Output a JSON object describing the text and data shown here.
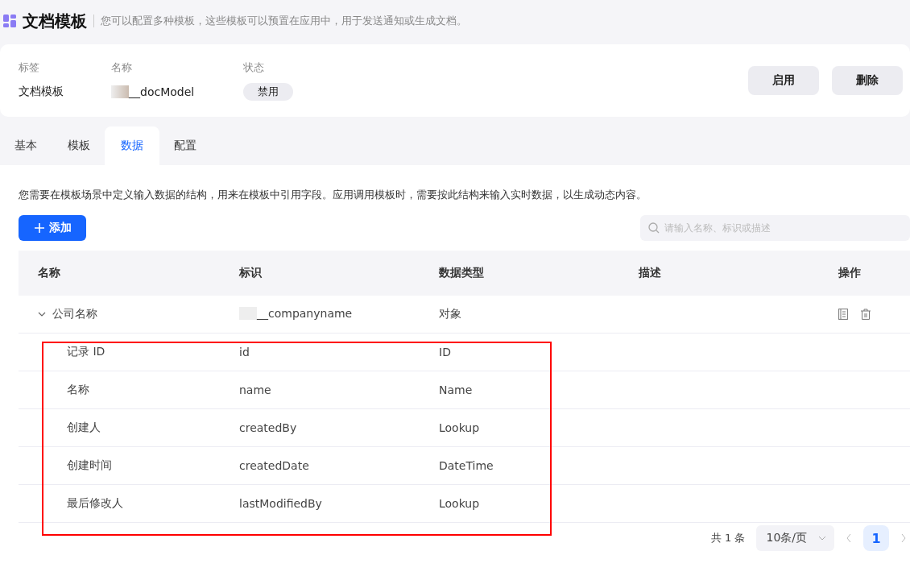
{
  "header": {
    "title": "文档模板",
    "description": "您可以配置多种模板，这些模板可以预置在应用中，用于发送通知或生成文档。"
  },
  "info": {
    "fields": [
      {
        "label": "标签",
        "value": "文档模板",
        "kind": "text"
      },
      {
        "label": "名称",
        "value": "__docModel",
        "kind": "redacted"
      },
      {
        "label": "状态",
        "value": "禁用",
        "kind": "tag"
      }
    ],
    "buttons": [
      "启用",
      "删除"
    ]
  },
  "tabs": [
    {
      "label": "基本",
      "selected": false
    },
    {
      "label": "模板",
      "selected": false
    },
    {
      "label": "数据",
      "selected": true
    },
    {
      "label": "配置",
      "selected": false
    }
  ],
  "intro": "您需要在模板场景中定义输入数据的结构，用来在模板中引用字段。应用调用模板时，需要按此结构来输入实时数据，以生成动态内容。",
  "add_button": "添加",
  "search": {
    "placeholder": "请输入名称、标识或描述"
  },
  "table": {
    "columns": [
      "名称",
      "标识",
      "数据类型",
      "描述",
      "操作"
    ],
    "rows": [
      {
        "name": "公司名称",
        "key": "__companyname",
        "key_redacted": true,
        "type": "对象",
        "expanded": true,
        "children": [
          {
            "name": "记录 ID",
            "key": "id",
            "type": "ID"
          },
          {
            "name": "名称",
            "key": "name",
            "type": "Name"
          },
          {
            "name": "创建人",
            "key": "createdBy",
            "type": "Lookup"
          },
          {
            "name": "创建时间",
            "key": "createdDate",
            "type": "DateTime"
          },
          {
            "name": "最后修改人",
            "key": "lastModifiedBy",
            "type": "Lookup"
          }
        ]
      }
    ]
  },
  "pagination": {
    "total": "共 1 条",
    "page_size": "10条/页",
    "pages": [
      {
        "label": "1",
        "selected": true
      }
    ]
  }
}
